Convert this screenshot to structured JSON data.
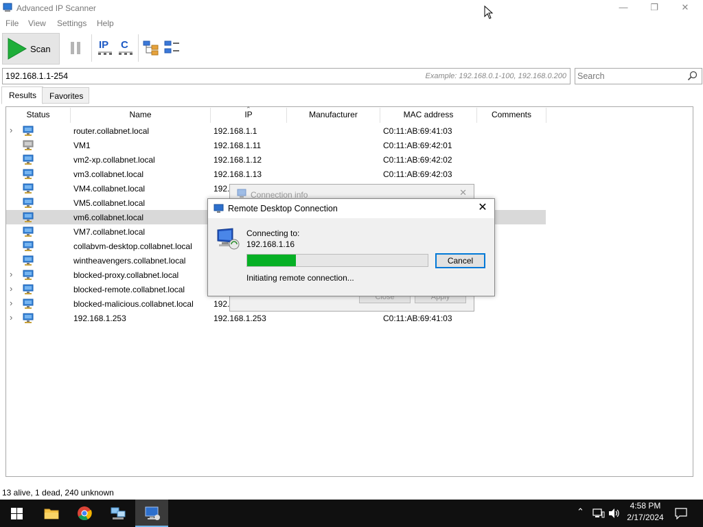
{
  "window": {
    "title": "Advanced IP Scanner"
  },
  "menu": [
    "File",
    "View",
    "Settings",
    "Help"
  ],
  "toolbar": {
    "scan_label": "Scan",
    "ip_label": "IP",
    "c_label": "C"
  },
  "address": {
    "value": "192.168.1.1-254",
    "example": "Example: 192.168.0.1-100, 192.168.0.200"
  },
  "search": {
    "placeholder": "Search"
  },
  "tabs": [
    {
      "label": "Results"
    },
    {
      "label": "Favorites"
    }
  ],
  "columns": [
    "Status",
    "Name",
    "IP",
    "Manufacturer",
    "MAC address",
    "Comments"
  ],
  "rows": [
    {
      "name": "router.collabnet.local",
      "ip": "192.168.1.1",
      "mac": "C0:11:AB:69:41:03",
      "expandable": true
    },
    {
      "name": "VM1",
      "ip": "192.168.1.11",
      "mac": "C0:11:AB:69:42:01",
      "expandable": false
    },
    {
      "name": "vm2-xp.collabnet.local",
      "ip": "192.168.1.12",
      "mac": "C0:11:AB:69:42:02",
      "expandable": false
    },
    {
      "name": "vm3.collabnet.local",
      "ip": "192.168.1.13",
      "mac": "C0:11:AB:69:42:03",
      "expandable": false
    },
    {
      "name": "VM4.collabnet.local",
      "ip": "192.",
      "mac": "",
      "expandable": false
    },
    {
      "name": "VM5.collabnet.local",
      "ip": "",
      "mac": "",
      "expandable": false
    },
    {
      "name": "vm6.collabnet.local",
      "ip": "",
      "mac": "",
      "expandable": false,
      "selected": true
    },
    {
      "name": "VM7.collabnet.local",
      "ip": "",
      "mac": "",
      "expandable": false
    },
    {
      "name": "collabvm-desktop.collabnet.local",
      "ip": "",
      "mac": "",
      "expandable": false
    },
    {
      "name": "wintheavengers.collabnet.local",
      "ip": "",
      "mac": "",
      "expandable": false
    },
    {
      "name": "blocked-proxy.collabnet.local",
      "ip": "",
      "mac": "",
      "expandable": true
    },
    {
      "name": "blocked-remote.collabnet.local",
      "ip": "",
      "mac": "",
      "expandable": true
    },
    {
      "name": "blocked-malicious.collabnet.local",
      "ip": "192.",
      "mac": "",
      "expandable": true
    },
    {
      "name": "192.168.1.253",
      "ip": "192.168.1.253",
      "mac": "C0:11:AB:69:41:03",
      "expandable": true
    }
  ],
  "conninfo": {
    "title": "Connection info",
    "close_label": "Close",
    "apply_label": "Apply"
  },
  "rdp": {
    "title": "Remote Desktop Connection",
    "connecting_label": "Connecting to:",
    "host": "192.168.1.16",
    "progress": 0.27,
    "cancel_label": "Cancel",
    "status": "Initiating remote connection..."
  },
  "statusbar": {
    "text": "13 alive, 1 dead, 240 unknown"
  },
  "taskbar": {
    "time": "4:58 PM",
    "date": "2/17/2024"
  },
  "colors": {
    "progress_fill": "#06b025",
    "accent": "#0078d7",
    "scan_green": "#1fae3a"
  }
}
